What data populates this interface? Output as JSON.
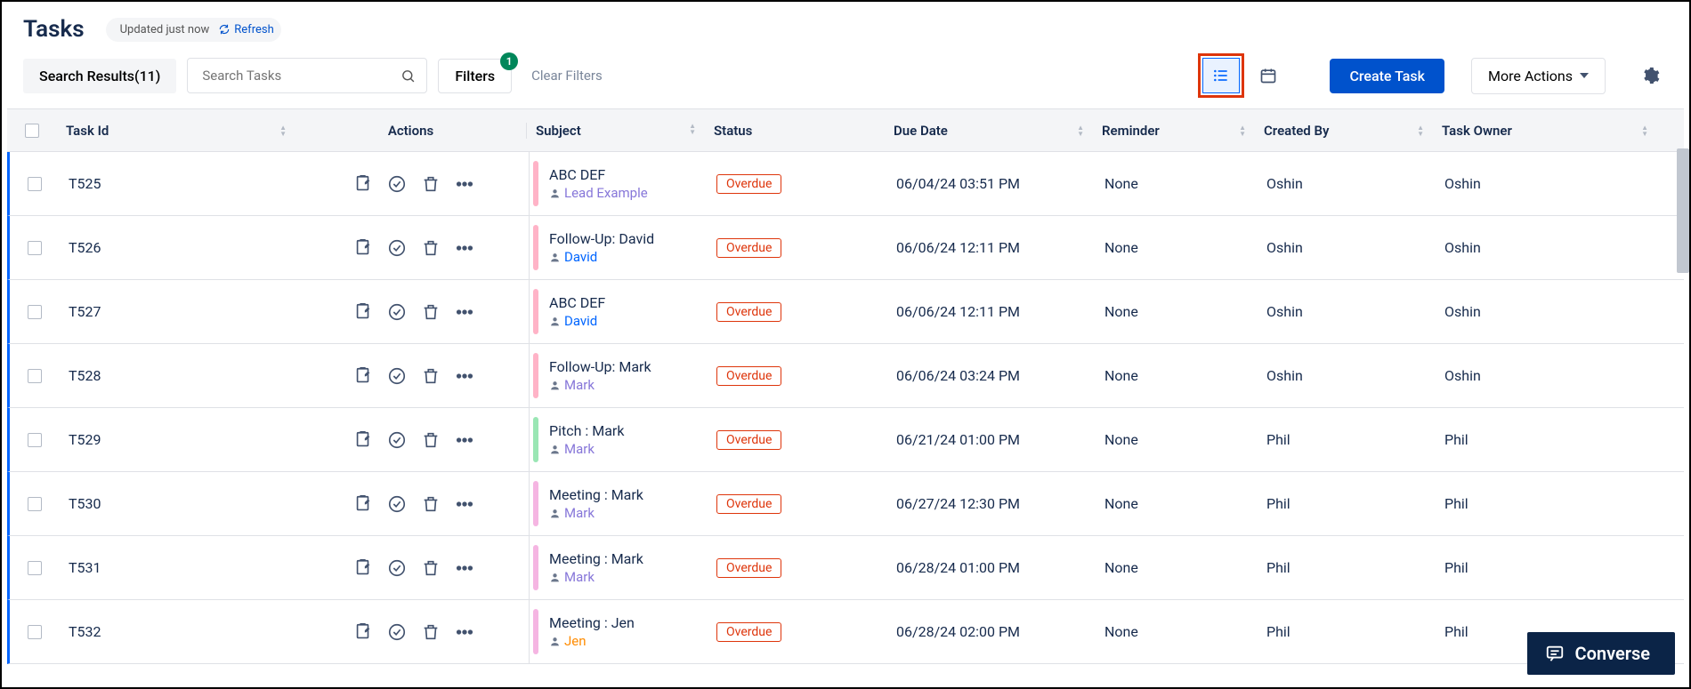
{
  "header": {
    "title": "Tasks",
    "updated_label": "Updated just now",
    "refresh_label": "Refresh"
  },
  "toolbar": {
    "search_results_label": "Search Results(11)",
    "search_placeholder": "Search Tasks",
    "filters_label": "Filters",
    "filter_count": "1",
    "clear_filters_label": "Clear Filters",
    "create_task_label": "Create Task",
    "more_actions_label": "More Actions"
  },
  "columns": {
    "task_id": "Task Id",
    "actions": "Actions",
    "subject": "Subject",
    "status": "Status",
    "due_date": "Due Date",
    "reminder": "Reminder",
    "created_by": "Created By",
    "task_owner": "Task Owner"
  },
  "status_labels": {
    "overdue": "Overdue"
  },
  "rows": [
    {
      "id": "T525",
      "subject": "ABC DEF",
      "link": "Lead Example",
      "link_style": "purple",
      "bar": "#FFB3C7",
      "status": "overdue",
      "due": "06/04/24 03:51 PM",
      "reminder": "None",
      "created_by": "Oshin",
      "owner": "Oshin"
    },
    {
      "id": "T526",
      "subject": "Follow-Up: David",
      "link": "David",
      "link_style": "blue",
      "bar": "#FFB3C7",
      "status": "overdue",
      "due": "06/06/24 12:11 PM",
      "reminder": "None",
      "created_by": "Oshin",
      "owner": "Oshin"
    },
    {
      "id": "T527",
      "subject": "ABC DEF",
      "link": "David",
      "link_style": "blue",
      "bar": "#FFB3C7",
      "status": "overdue",
      "due": "06/06/24 12:11 PM",
      "reminder": "None",
      "created_by": "Oshin",
      "owner": "Oshin"
    },
    {
      "id": "T528",
      "subject": "Follow-Up: Mark",
      "link": "Mark",
      "link_style": "purple",
      "bar": "#FFB3C7",
      "status": "overdue",
      "due": "06/06/24 03:24 PM",
      "reminder": "None",
      "created_by": "Oshin",
      "owner": "Oshin"
    },
    {
      "id": "T529",
      "subject": "Pitch : Mark",
      "link": "Mark",
      "link_style": "purple",
      "bar": "#9AE6B4",
      "status": "overdue",
      "due": "06/21/24 01:00 PM",
      "reminder": "None",
      "created_by": "Phil",
      "owner": "Phil"
    },
    {
      "id": "T530",
      "subject": "Meeting : Mark",
      "link": "Mark",
      "link_style": "purple",
      "bar": "#F5B5E2",
      "status": "overdue",
      "due": "06/27/24 12:30 PM",
      "reminder": "None",
      "created_by": "Phil",
      "owner": "Phil"
    },
    {
      "id": "T531",
      "subject": "Meeting : Mark",
      "link": "Mark",
      "link_style": "purple",
      "bar": "#F5B5E2",
      "status": "overdue",
      "due": "06/28/24 01:00 PM",
      "reminder": "None",
      "created_by": "Phil",
      "owner": "Phil"
    },
    {
      "id": "T532",
      "subject": "Meeting : Jen",
      "link": "Jen",
      "link_style": "orange",
      "bar": "#F5B5E2",
      "status": "overdue",
      "due": "06/28/24 02:00 PM",
      "reminder": "None",
      "created_by": "Phil",
      "owner": "Phil"
    }
  ],
  "converse_label": "Converse"
}
